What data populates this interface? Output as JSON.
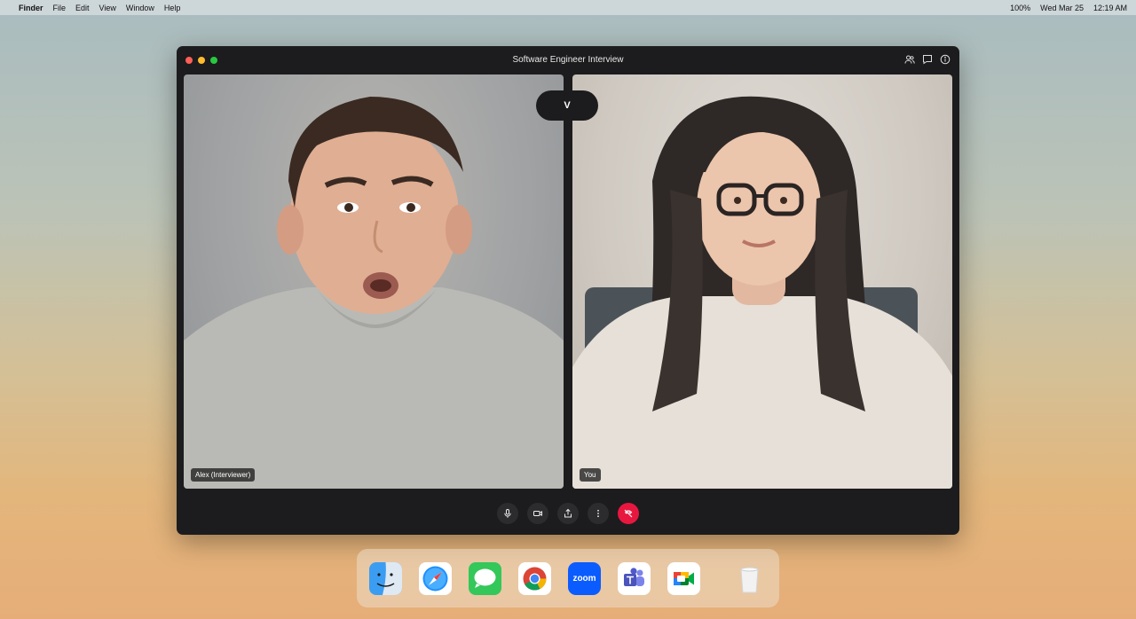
{
  "menubar": {
    "apple_icon": "apple-icon",
    "app_name": "Finder",
    "menus": [
      "File",
      "Edit",
      "View",
      "Window",
      "Help"
    ],
    "battery": "100%",
    "date": "Wed Mar 25",
    "time": "12:19 AM"
  },
  "window": {
    "title": "Software Engineer Interview",
    "toolbar_icons": [
      "participants-icon",
      "chat-icon",
      "info-icon"
    ],
    "brand_mark": "V"
  },
  "participants": [
    {
      "label": "Alex (Interviewer)"
    },
    {
      "label": "You"
    }
  ],
  "controls": [
    "microphone-icon",
    "camera-icon",
    "share-screen-icon",
    "more-icon",
    "end-call-icon"
  ],
  "dock": {
    "apps": [
      "Finder",
      "Safari",
      "Messages",
      "Chrome",
      "Zoom",
      "Teams",
      "Google Meet",
      "Trash"
    ],
    "zoom_label": "zoom"
  },
  "colors": {
    "end_call": "#e8173f",
    "window_bg": "#1c1c1e"
  }
}
